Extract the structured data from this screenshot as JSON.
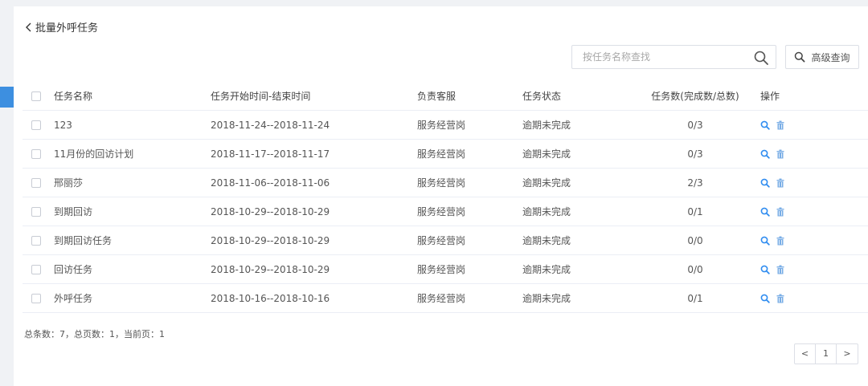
{
  "header": {
    "title": "批量外呼任务"
  },
  "search": {
    "placeholder": "按任务名称查找",
    "value": ""
  },
  "toolbar": {
    "advanced_label": "高级查询"
  },
  "colors": {
    "accent": "#3d8fe0",
    "icon_blue": "#2f8cf0",
    "trash_blue": "#7aaee6"
  },
  "table": {
    "headers": {
      "name": "任务名称",
      "time": "任务开始时间-结束时间",
      "staff": "负责客服",
      "status": "任务状态",
      "count": "任务数(完成数/总数)",
      "ops": "操作"
    },
    "rows": [
      {
        "name": "123",
        "time": "2018-11-24--2018-11-24",
        "staff": "服务经营岗",
        "status": "逾期未完成",
        "count": "0/3"
      },
      {
        "name": "11月份的回访计划",
        "time": "2018-11-17--2018-11-17",
        "staff": "服务经营岗",
        "status": "逾期未完成",
        "count": "0/3"
      },
      {
        "name": "邢丽莎",
        "time": "2018-11-06--2018-11-06",
        "staff": "服务经营岗",
        "status": "逾期未完成",
        "count": "2/3"
      },
      {
        "name": "到期回访",
        "time": "2018-10-29--2018-10-29",
        "staff": "服务经营岗",
        "status": "逾期未完成",
        "count": "0/1"
      },
      {
        "name": "到期回访任务",
        "time": "2018-10-29--2018-10-29",
        "staff": "服务经营岗",
        "status": "逾期未完成",
        "count": "0/0"
      },
      {
        "name": "回访任务",
        "time": "2018-10-29--2018-10-29",
        "staff": "服务经营岗",
        "status": "逾期未完成",
        "count": "0/0"
      },
      {
        "name": "外呼任务",
        "time": "2018-10-16--2018-10-16",
        "staff": "服务经营岗",
        "status": "逾期未完成",
        "count": "0/1"
      }
    ]
  },
  "footer": {
    "summary": "总条数：7，总页数：1，当前页：1"
  },
  "pagination": {
    "prev": "<",
    "current": "1",
    "next": ">"
  },
  "icons": {
    "back": "chevron-left-icon",
    "search": "search-icon",
    "view": "search-icon",
    "delete": "trash-icon"
  }
}
